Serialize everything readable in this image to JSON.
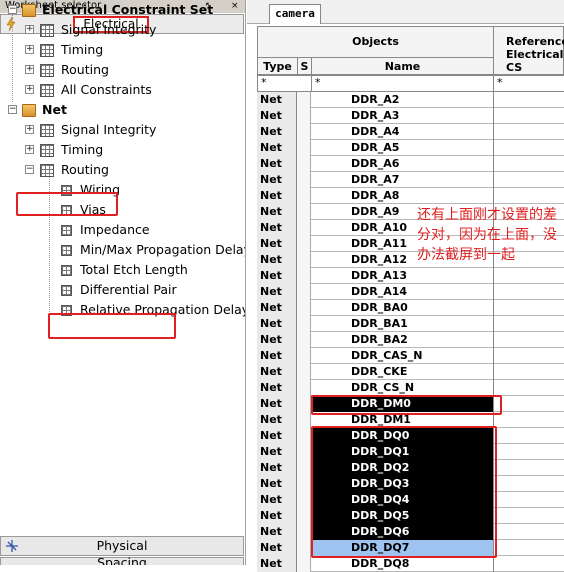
{
  "worksheet_selector": {
    "title": "Worksheet selector",
    "pin": "↖",
    "close": "×",
    "active_tab": "Electrical",
    "tree": [
      {
        "label": "Electrical Constraint Set",
        "bold": true
      },
      {
        "label": "Signal Integrity"
      },
      {
        "label": "Timing"
      },
      {
        "label": "Routing"
      },
      {
        "label": "All Constraints"
      },
      {
        "label": "Net",
        "bold": true
      },
      {
        "label": "Signal Integrity"
      },
      {
        "label": "Timing"
      },
      {
        "label": "Routing"
      },
      {
        "label": "Wiring"
      },
      {
        "label": "Vias"
      },
      {
        "label": "Impedance"
      },
      {
        "label": "Min/Max Propagation Delay"
      },
      {
        "label": "Total Etch Length"
      },
      {
        "label": "Differential Pair"
      },
      {
        "label": "Relative Propagation Delay"
      }
    ],
    "bottom_tabs": [
      "Physical",
      "Spacing"
    ]
  },
  "main": {
    "tab": "camera",
    "headers": {
      "objects": "Objects",
      "type": "Type",
      "s": "S",
      "name": "Name",
      "ref1": "Reference",
      "ref2": "Electrical CS"
    },
    "filter": {
      "type": "*",
      "name": "*",
      "ref": "*"
    },
    "rows": [
      {
        "type": "Net",
        "name": "DDR_A2",
        "state": ""
      },
      {
        "type": "Net",
        "name": "DDR_A3",
        "state": ""
      },
      {
        "type": "Net",
        "name": "DDR_A4",
        "state": ""
      },
      {
        "type": "Net",
        "name": "DDR_A5",
        "state": ""
      },
      {
        "type": "Net",
        "name": "DDR_A6",
        "state": ""
      },
      {
        "type": "Net",
        "name": "DDR_A7",
        "state": ""
      },
      {
        "type": "Net",
        "name": "DDR_A8",
        "state": ""
      },
      {
        "type": "Net",
        "name": "DDR_A9",
        "state": ""
      },
      {
        "type": "Net",
        "name": "DDR_A10",
        "state": ""
      },
      {
        "type": "Net",
        "name": "DDR_A11",
        "state": ""
      },
      {
        "type": "Net",
        "name": "DDR_A12",
        "state": ""
      },
      {
        "type": "Net",
        "name": "DDR_A13",
        "state": ""
      },
      {
        "type": "Net",
        "name": "DDR_A14",
        "state": ""
      },
      {
        "type": "Net",
        "name": "DDR_BA0",
        "state": ""
      },
      {
        "type": "Net",
        "name": "DDR_BA1",
        "state": ""
      },
      {
        "type": "Net",
        "name": "DDR_BA2",
        "state": ""
      },
      {
        "type": "Net",
        "name": "DDR_CAS_N",
        "state": ""
      },
      {
        "type": "Net",
        "name": "DDR_CKE",
        "state": ""
      },
      {
        "type": "Net",
        "name": "DDR_CS_N",
        "state": ""
      },
      {
        "type": "Net",
        "name": "DDR_DM0",
        "state": "sel"
      },
      {
        "type": "Net",
        "name": "DDR_DM1",
        "state": ""
      },
      {
        "type": "Net",
        "name": "DDR_DQ0",
        "state": "sel"
      },
      {
        "type": "Net",
        "name": "DDR_DQ1",
        "state": "sel"
      },
      {
        "type": "Net",
        "name": "DDR_DQ2",
        "state": "sel"
      },
      {
        "type": "Net",
        "name": "DDR_DQ3",
        "state": "sel"
      },
      {
        "type": "Net",
        "name": "DDR_DQ4",
        "state": "sel"
      },
      {
        "type": "Net",
        "name": "DDR_DQ5",
        "state": "sel"
      },
      {
        "type": "Net",
        "name": "DDR_DQ6",
        "state": "sel"
      },
      {
        "type": "Net",
        "name": "DDR_DQ7",
        "state": "hl"
      },
      {
        "type": "Net",
        "name": "DDR_DQ8",
        "state": ""
      }
    ]
  },
  "annotation": "还有上面刚才设置的差分对，因为在上面，没办法截屏到一起",
  "colors": {
    "annotation_red": "#e02020",
    "selection": "#000000",
    "highlight": "#9fc3f0"
  }
}
